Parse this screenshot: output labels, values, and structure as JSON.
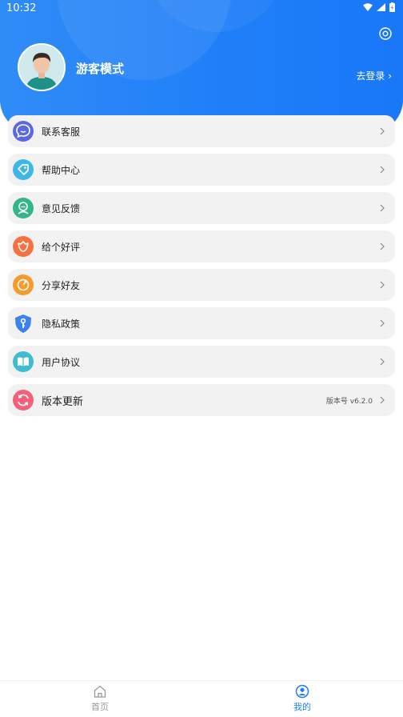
{
  "status": {
    "time": "10:32"
  },
  "profile": {
    "name": "游客模式",
    "login": "去登录"
  },
  "menu": [
    {
      "label": "联系客服",
      "color": "#5b68e6",
      "icon": "chat-bubble-icon"
    },
    {
      "label": "帮助中心",
      "color": "#3fb6e8",
      "icon": "tag-icon"
    },
    {
      "label": "意见反馈",
      "color": "#33b58a",
      "icon": "feedback-icon"
    },
    {
      "label": "给个好评",
      "color": "#f5713d",
      "icon": "flower-icon"
    },
    {
      "label": "分享好友",
      "color": "#f79a2c",
      "icon": "share-icon"
    },
    {
      "label": "隐私政策",
      "color": "#3b82f0",
      "icon": "shield-icon"
    },
    {
      "label": "用户协议",
      "color": "#3fbccf",
      "icon": "book-icon"
    },
    {
      "label": "版本更新",
      "color": "#f45f7a",
      "icon": "refresh-icon",
      "version": "版本号 v6.2.0"
    }
  ],
  "tabs": [
    {
      "label": "首页",
      "active": false
    },
    {
      "label": "我的",
      "active": true
    }
  ],
  "colors": {
    "accent": "#1e80f8",
    "tab_inactive": "#999999"
  }
}
